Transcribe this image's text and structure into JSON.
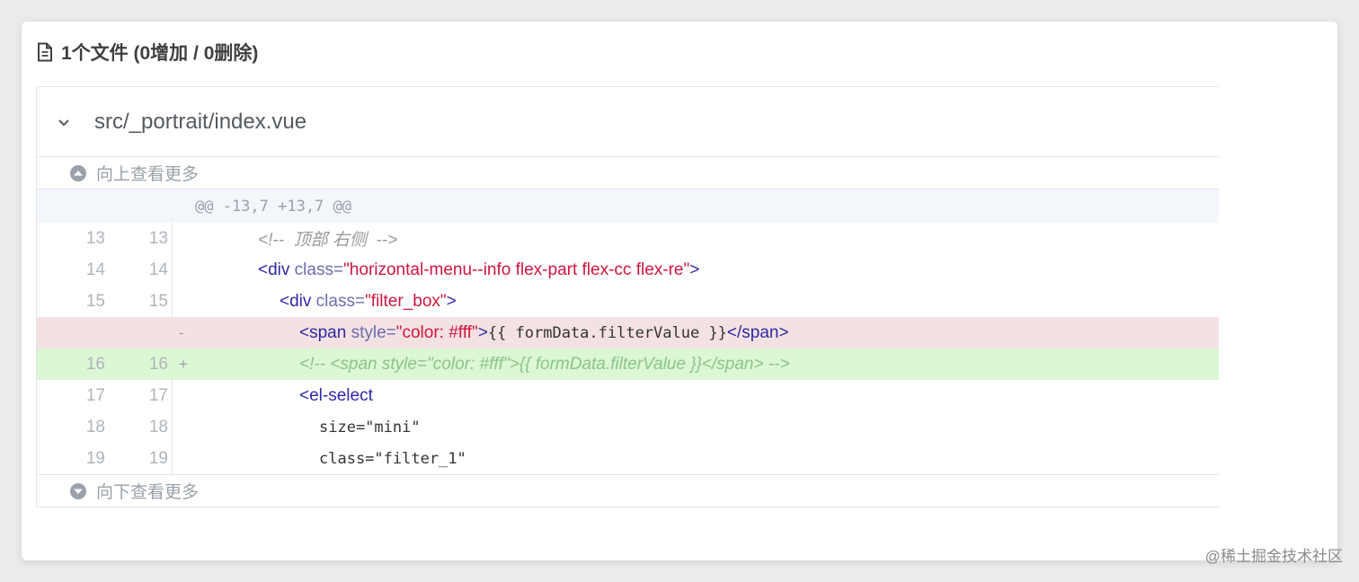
{
  "summary": {
    "icon": "document-icon",
    "text": "1个文件 (0增加 / 0删除)"
  },
  "file": {
    "chevron_icon": "chevron-down-icon",
    "name": "src/_portrait/index.vue"
  },
  "expand_up": {
    "icon": "arrow-up-circle-icon",
    "label": "向上查看更多"
  },
  "expand_down": {
    "icon": "arrow-down-circle-icon",
    "label": "向下查看更多"
  },
  "hunk_header": "@@ -13,7 +13,7 @@",
  "lines": [
    {
      "old": "13",
      "new": "13",
      "marker": "",
      "type": "context",
      "p1": "<!--  顶部 右侧  -->"
    },
    {
      "old": "14",
      "new": "14",
      "marker": "",
      "type": "context",
      "tag_open": "<div ",
      "attr": "class=",
      "str": "\"horizontal-menu--info flex-part flex-cc flex-re\"",
      "tag_close": ">"
    },
    {
      "old": "15",
      "new": "15",
      "marker": "",
      "type": "context",
      "tag_open": "<div ",
      "attr": "class=",
      "str": "\"filter_box\"",
      "tag_close": ">"
    },
    {
      "old": "",
      "new": "",
      "marker": "-",
      "type": "removed",
      "tag_open": "<span ",
      "attr": "style=",
      "str": "\"color: #fff\"",
      "tag_close": ">",
      "mono": "{{ formData.filterValue }}",
      "tag_end": "</span>"
    },
    {
      "old": "16",
      "new": "16",
      "marker": "+",
      "type": "added",
      "p1": "<!-- <span style=\"color: #fff\">{{ formData.filterValue }}</span> -->"
    },
    {
      "old": "17",
      "new": "17",
      "marker": "",
      "type": "context",
      "tag_open": "<el-select"
    },
    {
      "old": "18",
      "new": "18",
      "marker": "",
      "type": "context",
      "mono": "size=\"mini\""
    },
    {
      "old": "19",
      "new": "19",
      "marker": "",
      "type": "context",
      "mono": "class=\"filter_1\""
    }
  ],
  "watermark": "@稀土掘金技术社区",
  "colors": {
    "removed_bg": "#f4e2e3",
    "added_bg": "#dcf7d4",
    "hunk_bg": "#f3f7fb",
    "string": "#d0163f",
    "tag": "#2e2aa6"
  }
}
